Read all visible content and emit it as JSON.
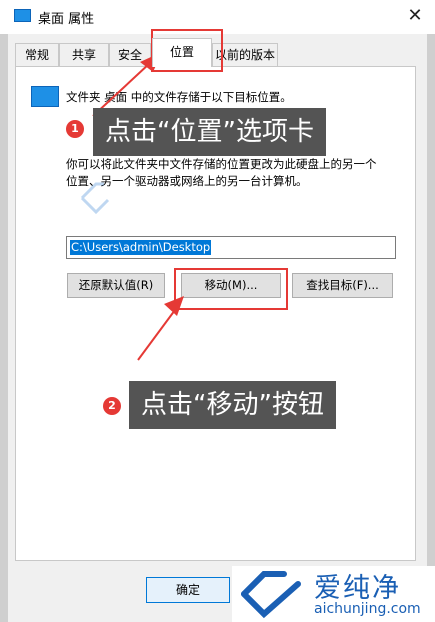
{
  "window": {
    "title": "桌面 属性",
    "close_glyph": "✕"
  },
  "tabs": [
    {
      "label": "常规"
    },
    {
      "label": "共享"
    },
    {
      "label": "安全"
    },
    {
      "label": "位置",
      "active": true
    },
    {
      "label": "以前的版本"
    }
  ],
  "location": {
    "description": "文件夹 桌面 中的文件存储于以下目标位置。",
    "detail_line1": "你可以将此文件夹中文件存储的位置更改为此硬盘上的另一个",
    "detail_line2": "位置、另一个驱动器或网络上的另一台计算机。",
    "path_value": "C:\\Users\\admin\\Desktop",
    "restore_default_label": "还原默认值(R)",
    "move_label": "移动(M)...",
    "find_target_label": "查找目标(F)..."
  },
  "footer": {
    "ok_label": "确定"
  },
  "annotations": [
    {
      "number": "1",
      "text": "点击“位置”选项卡"
    },
    {
      "number": "2",
      "text": "点击“移动”按钮"
    }
  ],
  "watermark": {
    "name": "爱纯净",
    "url": "aichunjing.com"
  },
  "colors": {
    "accent": "#0078d7",
    "highlight": "#e53935",
    "callout_bg": "#545454",
    "folder": "#1e90e6",
    "watermark": "#1a5fb4"
  }
}
